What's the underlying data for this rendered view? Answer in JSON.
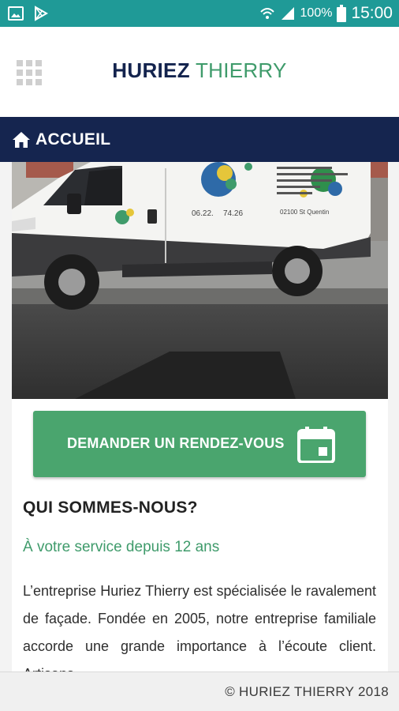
{
  "statusbar": {
    "battery": "100%",
    "time": "15:00",
    "icons": [
      "gallery-icon",
      "play-store-icon",
      "wifi-icon",
      "signal-icon",
      "battery-icon"
    ]
  },
  "appbar": {
    "menu_icon": "apps-grid-icon",
    "brand_part1": "HURIEZ",
    "brand_part2": "THIERRY"
  },
  "nav": {
    "icon": "home-icon",
    "label": "ACCUEIL"
  },
  "hero": {
    "van_phone": "06.22.",
    "van_phone_tail": "74.26",
    "van_city": "02100 St Quentin"
  },
  "cta": {
    "label": "DEMANDER UN RENDEZ-VOUS",
    "icon": "calendar-icon"
  },
  "about": {
    "heading": "QUI SOMMES-NOUS?",
    "subheading": "À votre service depuis 12 ans",
    "body": "L’entreprise Huriez Thierry est spécialisée le ravalement de façade. Fondée en 2005, notre entreprise familiale accorde une grande importance à l’écoute client. Artisans"
  },
  "footer": {
    "copyright": "© HURIEZ THIERRY 2018"
  },
  "colors": {
    "statusbar": "#1f9a97",
    "navbar": "#15254f",
    "accent_green": "#4aa56e",
    "brand_navy": "#14244e"
  }
}
